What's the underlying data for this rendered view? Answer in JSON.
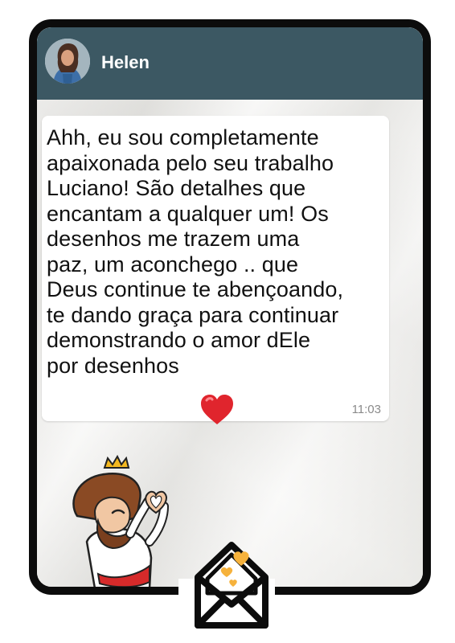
{
  "chat": {
    "contact_name": "Helen",
    "message": {
      "text": "Ahh, eu sou completamente\napaixonada pelo seu trabalho\nLuciano! São detalhes que\nencantam a qualquer um! Os\ndesenhos me trazem uma\npaz, um aconchego .. que\nDeus continue te abençoando,\nte dando graça para continuar\ndemonstrando o amor dEle\npor desenhos",
      "emoji": "red-heart",
      "time": "11:03"
    }
  },
  "icons": {
    "avatar": "profile-photo",
    "sticker": "jesus-heart-hands-sticker",
    "envelope": "envelope-hearts-icon"
  },
  "colors": {
    "header": "#3c5863",
    "frame": "#0c0c0c",
    "heart": "#e0252d",
    "envelope_hearts": "#f6b23c"
  }
}
